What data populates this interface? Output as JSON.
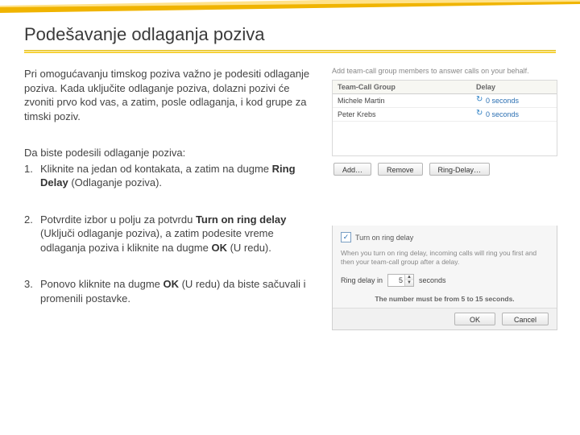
{
  "banner": {
    "present": true
  },
  "title": "Podešavanje odlaganja poziva",
  "intro": "Pri omogućavanju timskog poziva važno je podesiti odlaganje poziva. Kada uključite odlaganje poziva, dolazni pozivi će zvoniti prvo kod vas, a zatim, posle odlaganja, i kod grupe za timski poziv.",
  "steps_intro": "Da biste podesili odlaganje poziva:",
  "steps": {
    "s1": {
      "num": "1.",
      "pre": "Kliknite na jedan od kontakata, a zatim na dugme ",
      "bold": "Ring Delay",
      "post": " (Odlaganje poziva)."
    },
    "s2": {
      "num": "2.",
      "pre": "Potvrdite izbor u polju za potvrdu ",
      "bold": "Turn on ring delay",
      "mid": " (Uključi odlaganje poziva), a zatim podesite vreme odlaganja poziva i kliknite na dugme ",
      "bold2": "OK",
      "post": " (U redu)."
    },
    "s3": {
      "num": "3.",
      "pre": "Ponovo kliknite na dugme ",
      "bold": "OK",
      "post": " (U redu) da biste sačuvali i promenili postavke."
    }
  },
  "panel1": {
    "hint": "Add team-call group members to answer calls on your behalf.",
    "headers": {
      "group": "Team-Call Group",
      "delay": "Delay"
    },
    "rows": [
      {
        "name": "Michele Martin",
        "delay": "0 seconds"
      },
      {
        "name": "Peter Krebs",
        "delay": "0 seconds"
      }
    ],
    "btn_add": "Add…",
    "btn_remove": "Remove",
    "btn_ringdelay": "Ring-Delay…"
  },
  "panel2": {
    "cb_label": "Turn on ring delay",
    "cb_checked": "✓",
    "desc": "When you turn on ring delay, incoming calls will ring you first and then your team-call group after a delay.",
    "spin_pre": "Ring delay in",
    "spin_val": "5",
    "spin_post": "seconds",
    "warn": "The number must be from 5 to 15 seconds.",
    "btn_ok": "OK",
    "btn_cancel": "Cancel"
  }
}
